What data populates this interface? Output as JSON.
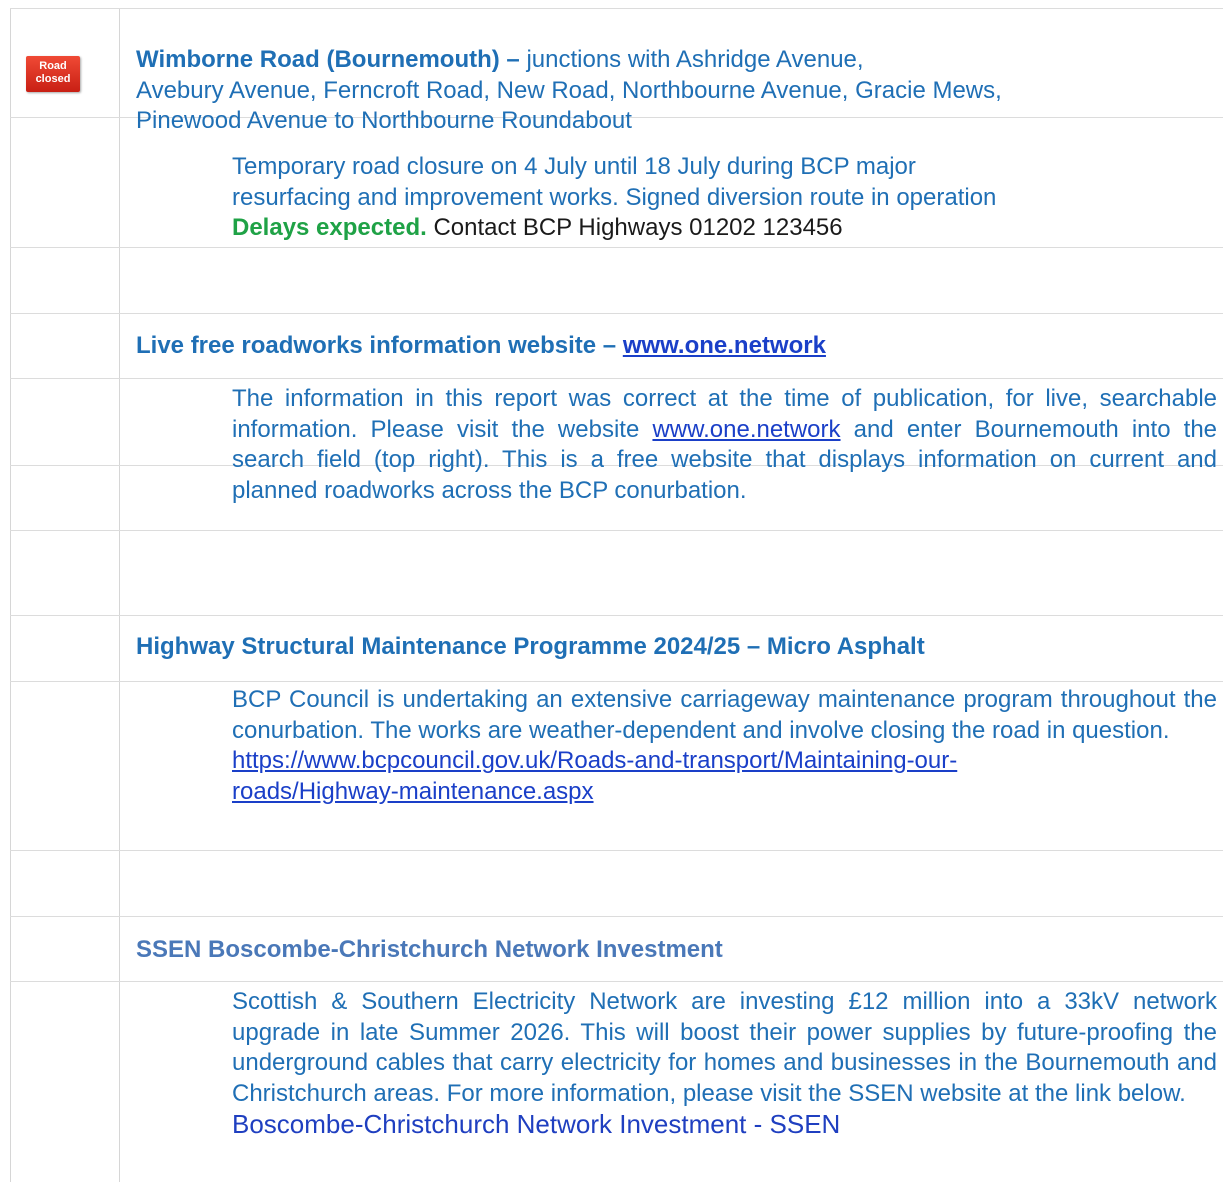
{
  "sections": [
    {
      "title": "Wimborne Road (Bournemouth) –",
      "title_rest": "junctions with Ashridge Avenue,",
      "title_line2": "Avebury Avenue, Ferncroft Road, New Road, Northbourne Avenue, Gracie Mews,",
      "title_line3": "Pinewood Avenue to Northbourne Roundabout",
      "icon": {
        "name": "road-closed-sign",
        "line1": "Road",
        "line2": "closed"
      },
      "body_line1": "Temporary road closure on 4 July until 18 July during BCP major",
      "body_line2": "resurfacing and improvement works. Signed diversion route in operation",
      "delays": "Delays expected.",
      "contact": "Contact BCP Highways 01202 123456"
    },
    {
      "title": "Live free roadworks information website –",
      "title_link": "www.one.network",
      "body_before": "The information in this report was correct at the time of publication, for live, searchable information. Please visit the website",
      "body_link": "www.one.network",
      "body_after": "and enter Bournemouth into the search field (top right). This is a free website that displays information on current and planned roadworks across the BCP conurbation."
    },
    {
      "title": "Highway Structural Maintenance Programme 2024/25 – Micro Asphalt",
      "body": "BCP Council is undertaking an extensive carriageway maintenance program throughout the conurbation. The works are weather-dependent and involve closing the road in question.",
      "link_line1": "https://www.bcpcouncil.gov.uk/Roads-and-transport/Maintaining-our-",
      "link_line2": "roads/Highway-maintenance.aspx"
    },
    {
      "title": "SSEN Boscombe-Christchurch Network Investment",
      "body": "Scottish & Southern Electricity Network are investing £12 million into a 33kV network upgrade in late Summer 2026. This will boost their power supplies by future-proofing the underground cables that carry electricity for homes and businesses in the Bournemouth and Christchurch areas. For more information, please visit the SSEN website at the link below.",
      "link": "Boscombe-Christchurch Network Investment - SSEN"
    }
  ],
  "colors": {
    "heading_blue": "#1f6fb5",
    "heading_steel": "#4a78b8",
    "delays_green": "#1fa246",
    "link": "#1a3fc8",
    "sign_red": "#e03a28"
  }
}
